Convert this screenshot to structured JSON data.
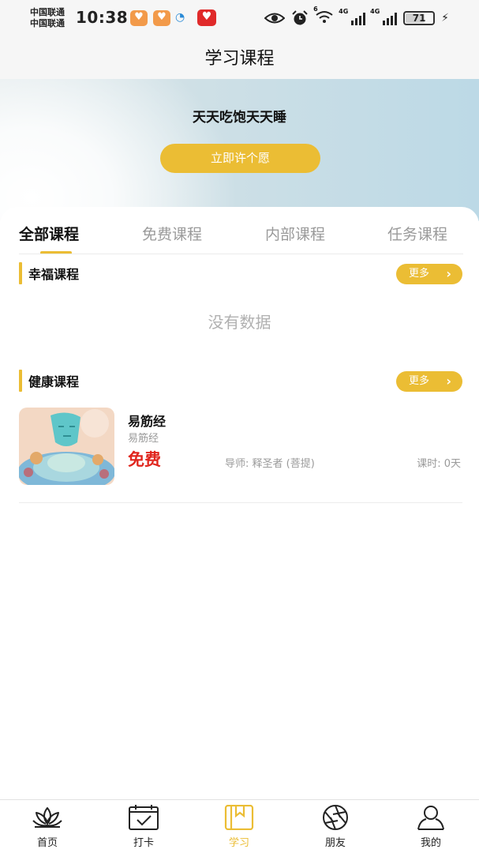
{
  "status_bar": {
    "carrier_1": "中国联通",
    "carrier_2": "中国联通",
    "time": "10:38",
    "wifi_badge": "6",
    "net_1": "4G",
    "net_2": "4G",
    "battery": "71",
    "battery_level": 0.71
  },
  "header": {
    "title": "学习课程"
  },
  "banner": {
    "text": "天天吃饱天天睡",
    "wish_button": "立即许个愿"
  },
  "tabs": [
    {
      "label": "全部课程",
      "active": true
    },
    {
      "label": "免费课程",
      "active": false
    },
    {
      "label": "内部课程",
      "active": false
    },
    {
      "label": "任务课程",
      "active": false
    }
  ],
  "sections": [
    {
      "title": "幸福课程",
      "more": "更多",
      "empty_text": "没有数据"
    },
    {
      "title": "健康课程",
      "more": "更多"
    }
  ],
  "course": {
    "title": "易筋经",
    "subtitle": "易筋经",
    "price": "免费",
    "teacher": "导师: 释圣者 (菩提)",
    "hours": "课时: 0天"
  },
  "bottom_nav": [
    {
      "label": "首页",
      "icon": "lotus-icon",
      "active": false
    },
    {
      "label": "打卡",
      "icon": "calendar-check-icon",
      "active": false
    },
    {
      "label": "学习",
      "icon": "book-icon",
      "active": true
    },
    {
      "label": "朋友",
      "icon": "aperture-icon",
      "active": false
    },
    {
      "label": "我的",
      "icon": "person-icon",
      "active": false
    }
  ],
  "colors": {
    "accent": "#ebbd34",
    "price": "#e0261e",
    "muted": "#9a9a9a"
  }
}
